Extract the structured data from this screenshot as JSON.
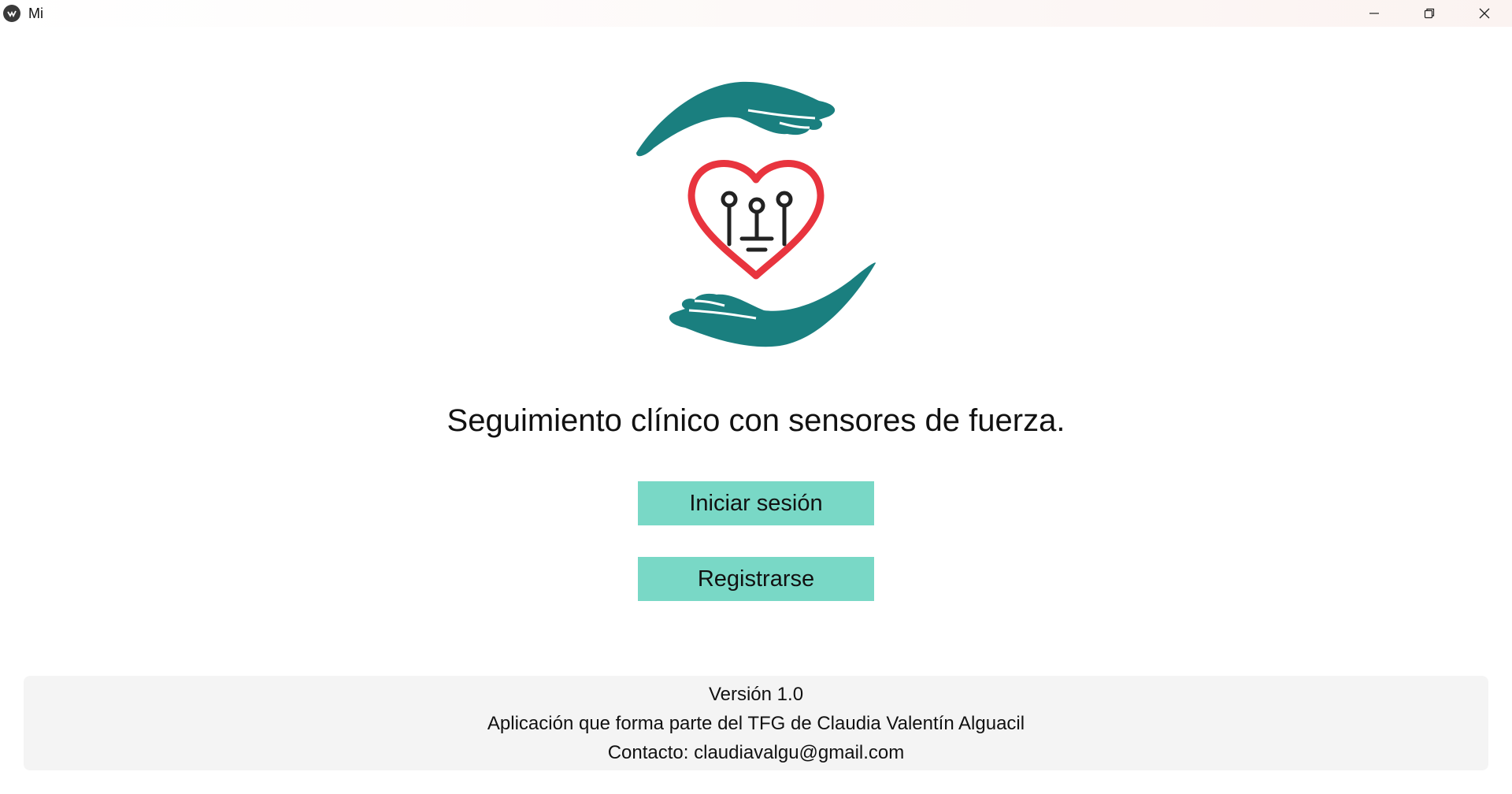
{
  "window": {
    "title": "Mi",
    "controls": {
      "minimize_icon": "minimize-icon",
      "restore_icon": "restore-icon",
      "close_icon": "close-icon"
    }
  },
  "logo": {
    "icon": "hands-heart-circuit-logo",
    "colors": {
      "hands": "#1a7f7f",
      "heart": "#e8343e",
      "circuit": "#222222"
    }
  },
  "main": {
    "tagline": "Seguimiento clínico con sensores de fuerza.",
    "login_label": "Iniciar sesión",
    "register_label": "Registrarse",
    "button_color": "#79d8c6"
  },
  "footer": {
    "version": "Versión 1.0",
    "description": "Aplicación que forma parte del TFG de Claudia Valentín Alguacil",
    "contact": "Contacto: claudiavalgu@gmail.com"
  }
}
